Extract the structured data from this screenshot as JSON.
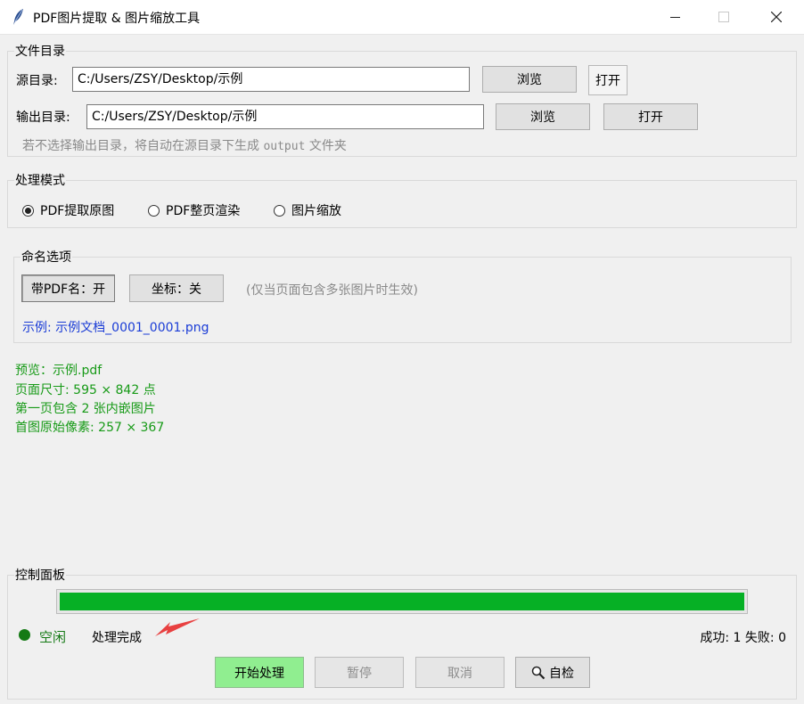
{
  "window": {
    "title": "PDF图片提取 & 图片缩放工具"
  },
  "directory": {
    "group_title": "文件目录",
    "source_label": "源目录:",
    "source_value": "C:/Users/ZSY/Desktop/示例",
    "output_label": "输出目录:",
    "output_value": "C:/Users/ZSY/Desktop/示例",
    "browse_label": "浏览",
    "open_label": "打开",
    "hint_prefix": "若不选择输出目录，将自动在源目录下生成",
    "hint_mono": "output",
    "hint_suffix": "文件夹"
  },
  "mode": {
    "group_title": "处理模式",
    "options": [
      {
        "label": "PDF提取原图",
        "selected": true
      },
      {
        "label": "PDF整页渲染",
        "selected": false
      },
      {
        "label": "图片缩放",
        "selected": false
      }
    ]
  },
  "naming": {
    "group_title": "命名选项",
    "pdf_name_button": "带PDF名：开",
    "coords_button": "坐标：关",
    "coords_hint": "(仅当页面包含多张图片时生效)",
    "example": "示例: 示例文档_0001_0001.png"
  },
  "preview": {
    "lines": [
      "预览：示例.pdf",
      "页面尺寸: 595 × 842 点",
      "第一页包含 2 张内嵌图片",
      "首图原始像素: 257 × 367"
    ]
  },
  "control": {
    "group_title": "控制面板",
    "progress": 1.0,
    "status_idle": "空闲",
    "status_message": "处理完成",
    "counts": "成功: 1  失败: 0",
    "start_label": "开始处理",
    "pause_label": "暂停",
    "cancel_label": "取消",
    "selfcheck_label": "自检"
  },
  "colors": {
    "progress": "#06b025",
    "preview_text": "#179a17",
    "example_text": "#1a3cd6",
    "start_button": "#90ee90",
    "annotation_arrow": "#e84040"
  }
}
